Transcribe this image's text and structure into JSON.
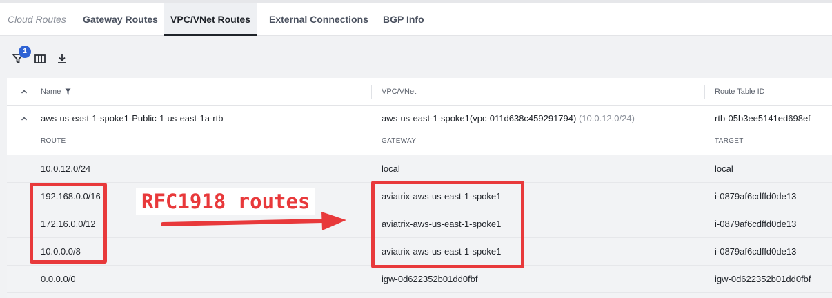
{
  "tabs": [
    {
      "label": "Cloud Routes"
    },
    {
      "label": "Gateway Routes"
    },
    {
      "label": "VPC/VNet Routes"
    },
    {
      "label": "External Connections"
    },
    {
      "label": "BGP Info"
    }
  ],
  "toolbar": {
    "filter_badge": "1",
    "icons": [
      "filter-icon",
      "columns-icon",
      "download-icon"
    ]
  },
  "table": {
    "columns": [
      "Name",
      "VPC/VNet",
      "Route Table ID"
    ],
    "group": {
      "name": "aws-us-east-1-spoke1-Public-1-us-east-1a-rtb",
      "vpc": "aws-us-east-1-spoke1(vpc-011d638c459291794)",
      "cidr": "(10.0.12.0/24)",
      "route_table_id": "rtb-05b3ee5141ed698ef",
      "subheaders": [
        "ROUTE",
        "GATEWAY",
        "TARGET"
      ]
    },
    "rows": [
      {
        "route": "10.0.12.0/24",
        "gateway": "local",
        "target": "local"
      },
      {
        "route": "192.168.0.0/16",
        "gateway": "aviatrix-aws-us-east-1-spoke1",
        "target": "i-0879af6cdffd0de13"
      },
      {
        "route": "172.16.0.0/12",
        "gateway": "aviatrix-aws-us-east-1-spoke1",
        "target": "i-0879af6cdffd0de13"
      },
      {
        "route": "10.0.0.0/8",
        "gateway": "aviatrix-aws-us-east-1-spoke1",
        "target": "i-0879af6cdffd0de13"
      },
      {
        "route": "0.0.0.0/0",
        "gateway": "igw-0d622352b01dd0fbf",
        "target": "igw-0d622352b01dd0fbf"
      }
    ]
  },
  "annotation": {
    "label": "RFC1918 routes",
    "color": "#e8393b"
  },
  "colors": {
    "badge": "#2f63d4",
    "active_tab_bg": "#eef0f3"
  }
}
